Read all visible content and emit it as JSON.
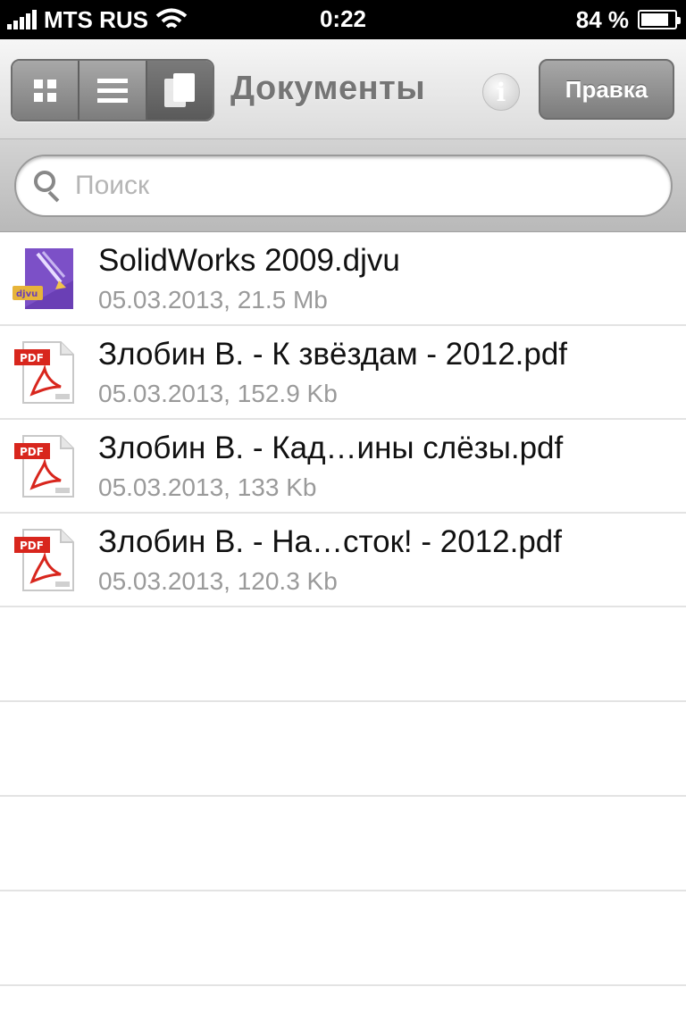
{
  "status_bar": {
    "carrier": "MTS RUS",
    "time": "0:22",
    "battery_text": "84 %",
    "battery_level": 0.84
  },
  "nav": {
    "title": "Документы",
    "edit_label": "Правка",
    "view_modes": [
      "grid",
      "list",
      "documents"
    ],
    "active_view": "documents"
  },
  "search": {
    "placeholder": "Поиск",
    "value": ""
  },
  "files": [
    {
      "name": "SolidWorks 2009.djvu",
      "meta": "05.03.2013, 21.5 Mb",
      "icon": "djvu-file-icon"
    },
    {
      "name": "Злобин В. - К звёздам - 2012.pdf",
      "meta": "05.03.2013, 152.9 Kb",
      "icon": "pdf-file-icon"
    },
    {
      "name": "Злобин В. - Кад…ины слёзы.pdf",
      "meta": "05.03.2013, 133 Kb",
      "icon": "pdf-file-icon"
    },
    {
      "name": "Злобин В. - На…сток! - 2012.pdf",
      "meta": "05.03.2013, 120.3 Kb",
      "icon": "pdf-file-icon"
    }
  ],
  "colors": {
    "djvu_purple": "#6a3fb5",
    "pdf_red": "#d8261d"
  }
}
